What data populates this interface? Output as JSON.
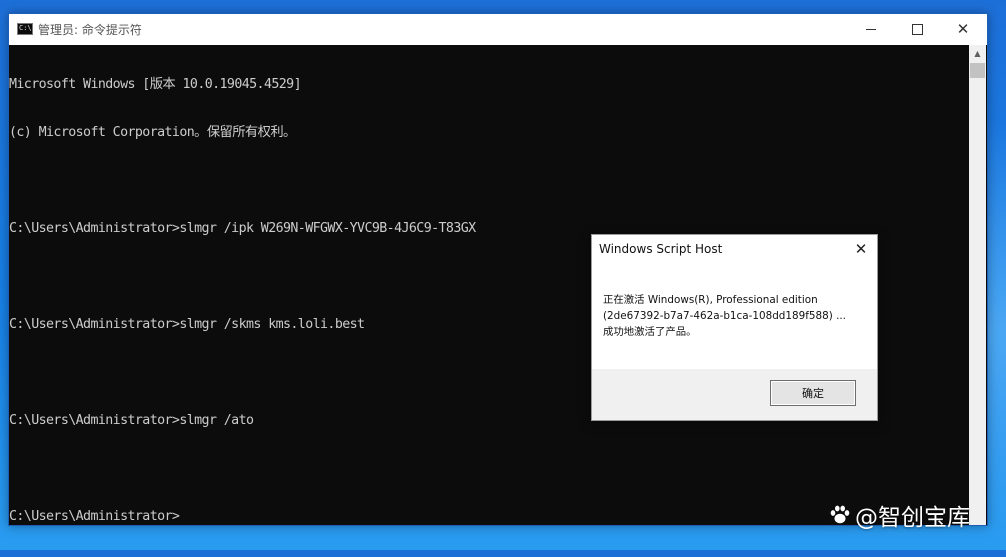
{
  "cmd_window": {
    "title": "管理员: 命令提示符",
    "icon_text": "C:\\",
    "lines": [
      "Microsoft Windows [版本 10.0.19045.4529]",
      "(c) Microsoft Corporation。保留所有权利。",
      "",
      "C:\\Users\\Administrator>slmgr /ipk W269N-WFGWX-YVC9B-4J6C9-T83GX",
      "",
      "C:\\Users\\Administrator>slmgr /skms kms.loli.best",
      "",
      "C:\\Users\\Administrator>slmgr /ato",
      "",
      "C:\\Users\\Administrator>"
    ],
    "controls": {
      "minimize_icon": "minimize-icon",
      "maximize_icon": "maximize-icon",
      "close_icon": "close-icon",
      "close_glyph": "✕"
    }
  },
  "dialog": {
    "title": "Windows Script Host",
    "close_glyph": "✕",
    "message_lines": [
      "正在激活 Windows(R), Professional edition",
      "(2de67392-b7a7-462a-b1ca-108dd189f588) ...",
      "成功地激活了产品。"
    ],
    "ok_label": "确定"
  },
  "watermark": {
    "text": "@智创宝库"
  },
  "colors": {
    "console_bg": "#0c0c0c",
    "console_text": "#cccccc",
    "desktop_blue": "#1780e6"
  }
}
